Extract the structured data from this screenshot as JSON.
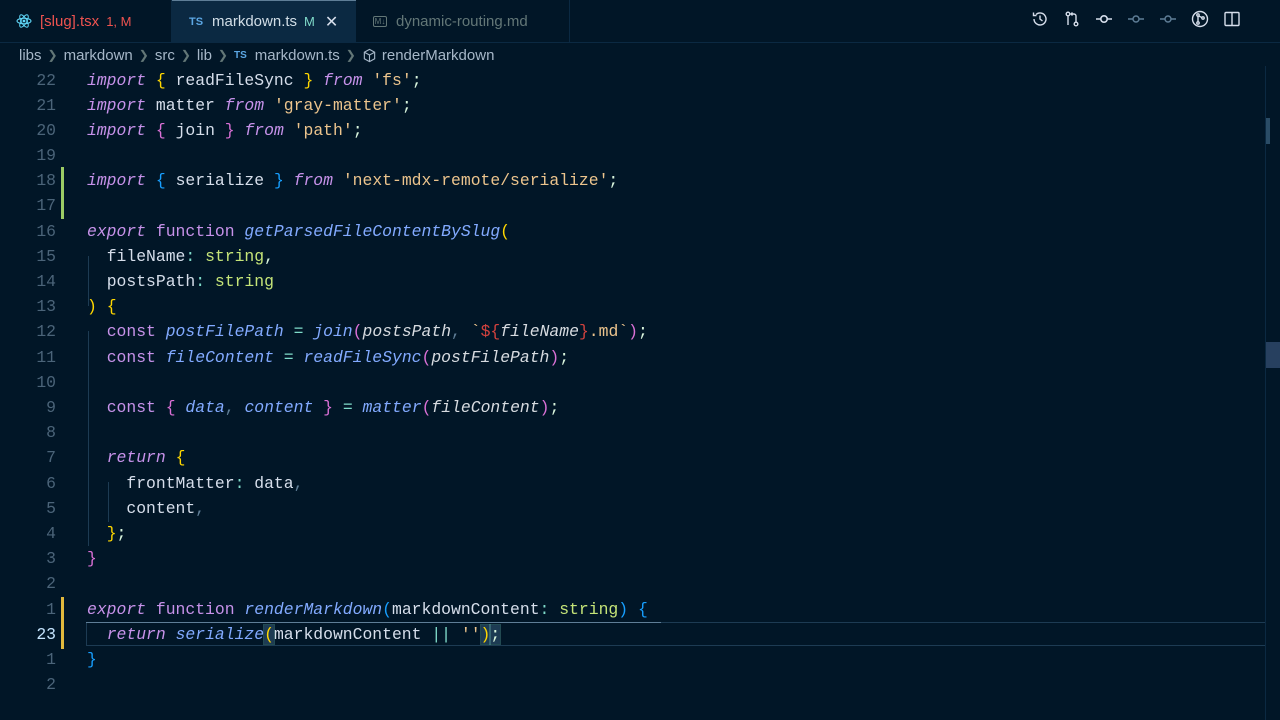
{
  "tabs": [
    {
      "label": "[slug].tsx",
      "status": "1, M",
      "icon": "react-icon"
    },
    {
      "label": "markdown.ts",
      "status": "M",
      "icon": "typescript-icon",
      "active": true
    },
    {
      "label": "dynamic-routing.md",
      "status": "",
      "icon": "markdown-icon"
    }
  ],
  "ts_badge": "TS",
  "md_badge": "M↓",
  "breadcrumb": {
    "items": [
      "libs",
      "markdown",
      "src",
      "lib"
    ],
    "file": "markdown.ts",
    "symbol": "renderMarkdown"
  },
  "toolbar_icons": [
    "timeline-icon",
    "source-control-compare-icon",
    "git-commit-icon",
    "git-prev-icon",
    "git-next-icon",
    "git-graph-icon",
    "split-editor-icon"
  ],
  "editor": {
    "line_numbers": [
      "22",
      "21",
      "20",
      "19",
      "18",
      "17",
      "16",
      "15",
      "14",
      "13",
      "12",
      "11",
      "10",
      "9",
      "8",
      "7",
      "6",
      "5",
      "4",
      "3",
      "2",
      "1",
      "23",
      "1",
      "2"
    ],
    "active_line": "23",
    "tokens": {
      "import": "import",
      "from": "from",
      "export": "export",
      "function": "function",
      "const": "const",
      "return": "return",
      "readFileSync": "readFileSync",
      "matter": "matter",
      "join": "join",
      "serialize": "serialize",
      "fs": "'fs'",
      "grayMatter": "'gray-matter'",
      "path": "'path'",
      "mdxRemote": "'next-mdx-remote/serialize'",
      "getParsed": "getParsedFileContentBySlug",
      "fileName": "fileName",
      "postsPath": "postsPath",
      "string": "string",
      "postFilePath": "postFilePath",
      "fileContent": "fileContent",
      "data": "data",
      "content": "content",
      "frontMatter": "frontMatter",
      "renderMarkdown": "renderMarkdown",
      "markdownContent": "markdownContent",
      "emptyStr": "''",
      "mdExt": ".md",
      "orOp": "||"
    }
  },
  "colors": {
    "background": "#011627",
    "keyword": "#c792ea",
    "function": "#82aaff",
    "string": "#ecc48d",
    "type": "#c5e478",
    "error": "#ef5350"
  }
}
